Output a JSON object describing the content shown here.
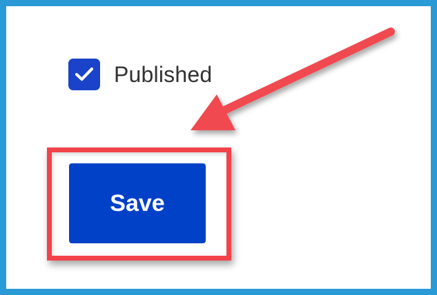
{
  "form": {
    "published_label": "Published",
    "published_checked": true,
    "save_label": "Save"
  },
  "colors": {
    "frame_border": "#2a9ad6",
    "checkbox": "#1a43c9",
    "button": "#0041c8",
    "highlight": "#f2424a",
    "arrow": "#f04850"
  },
  "annotations": {
    "highlight_target": "save-button",
    "arrow_target": "save-button"
  }
}
